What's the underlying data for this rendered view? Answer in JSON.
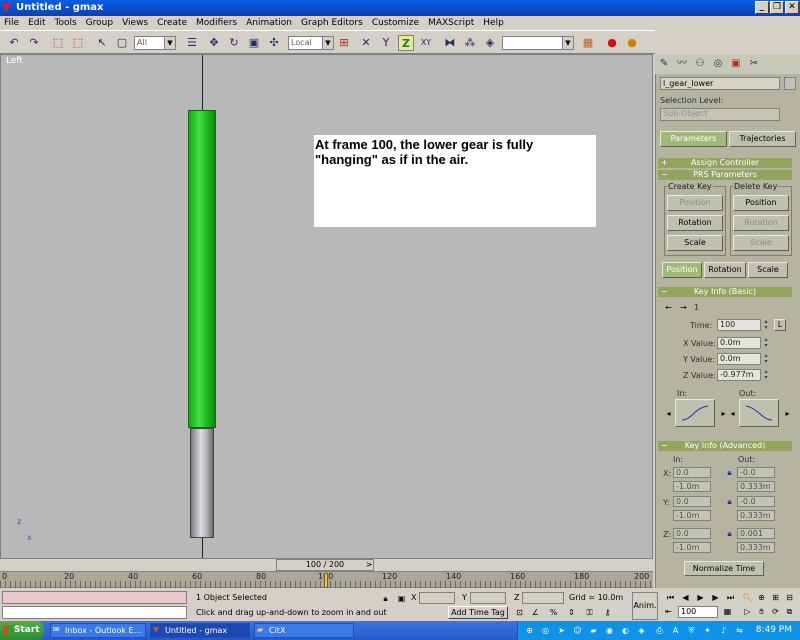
{
  "window": {
    "title": "Untitled - gmax",
    "minimize": "_",
    "maximize": "❐",
    "close": "✕"
  },
  "menu": [
    "File",
    "Edit",
    "Tools",
    "Group",
    "Views",
    "Create",
    "Modifiers",
    "Animation",
    "Graph Editors",
    "Customize",
    "MAXScript",
    "Help"
  ],
  "toolbar": {
    "selection_filter": "All",
    "ref_coord": "Local",
    "axis_z": "Z",
    "axis_xy": "XY",
    "named_sel": ""
  },
  "viewport": {
    "label": "Left",
    "note": "At frame 100, the lower gear is fully \"hanging\" as if in the air.",
    "axis_z": "z",
    "axis_x": "x",
    "colors": {
      "gear_green": "#22c022",
      "gear_gray": "#b4b4bc",
      "background": "#b8b8b8"
    }
  },
  "timeslider": {
    "label": "100 / 200",
    "prev": "<",
    "next": ">"
  },
  "trackbar": {
    "ticks": [
      "0",
      "20",
      "40",
      "60",
      "80",
      "100",
      "120",
      "140",
      "160",
      "180",
      "200"
    ]
  },
  "status": {
    "selection": "1 Object Selected",
    "prompt": "Click and drag up-and-down to zoom in and out",
    "x_label": "X",
    "y_label": "Y",
    "z_label": "Z",
    "grid": "Grid = 10.0m",
    "add_time_tag": "Add Time Tag",
    "anim": "Anim.",
    "frame": "100"
  },
  "panel": {
    "object_name": "l_gear_lower",
    "selection_level_label": "Selection Level:",
    "sub_object": "Sub-Object",
    "tab_parameters": "Parameters",
    "tab_trajectories": "Trajectories",
    "assign_controller": "Assign Controller",
    "prs_parameters": "PRS Parameters",
    "create_key": "Create Key",
    "delete_key": "Delete Key",
    "position": "Position",
    "rotation": "Rotation",
    "scale": "Scale",
    "key_info_basic": "Key Info (Basic)",
    "key_number": "1",
    "time_label": "Time:",
    "time_value": "100",
    "lock": "L",
    "x_value_label": "X Value:",
    "x_value": "0.0m",
    "y_value_label": "Y Value:",
    "y_value": "0.0m",
    "z_value_label": "Z Value:",
    "z_value": "-0.977m",
    "in_label": "In:",
    "out_label": "Out:",
    "key_info_advanced": "Key Info (Advanced)",
    "adv_in": "In:",
    "adv_out": "Out:",
    "adv_rows": [
      {
        "axis": "X:",
        "in": "0.0",
        "in2": "-1.0m",
        "out": "-0.0",
        "out2": "0.333m"
      },
      {
        "axis": "Y:",
        "in": "0.0",
        "in2": "-1.0m",
        "out": "-0.0",
        "out2": "0.333m"
      },
      {
        "axis": "Z:",
        "in": "0.0",
        "in2": "-1.0m",
        "out": "0.001",
        "out2": "0.333m"
      }
    ],
    "normalize_time": "Normalize Time"
  },
  "taskbar": {
    "start": "Start",
    "tasks": [
      "Inbox - Outlook E...",
      "Untitled - gmax",
      "CitX"
    ],
    "clock": "8:49 PM"
  }
}
